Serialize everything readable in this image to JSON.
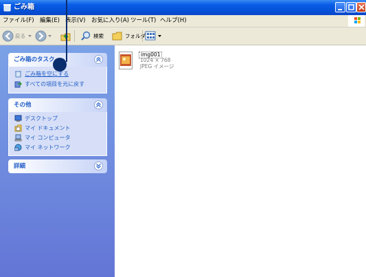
{
  "window": {
    "title": "ごみ箱"
  },
  "menu": [
    "ファイル(F)",
    "編集(E)",
    "表示(V)",
    "お気に入り(A)",
    "ツール(T)",
    "ヘルプ(H)"
  ],
  "toolbar": {
    "back_label": "戻る",
    "search_label": "検索",
    "folders_label": "フォルダ"
  },
  "tasks_panel": {
    "title": "ごみ箱のタスク",
    "items": [
      {
        "label": "ごみ箱を空にする",
        "icon": "empty-recycle-bin-icon"
      },
      {
        "label": "すべての項目を元に戻す",
        "icon": "restore-all-icon"
      }
    ]
  },
  "other_panel": {
    "title": "その他",
    "items": [
      {
        "label": "デスクトップ",
        "icon": "desktop-icon"
      },
      {
        "label": "マイ ドキュメント",
        "icon": "my-documents-icon"
      },
      {
        "label": "マイ コンピュータ",
        "icon": "my-computer-icon"
      },
      {
        "label": "マイ ネットワーク",
        "icon": "my-network-icon"
      }
    ]
  },
  "details_panel": {
    "title": "詳細"
  },
  "file": {
    "name": "img001",
    "dimensions": "1024 × 768",
    "type": "JPEG イメージ"
  },
  "colors": {
    "titlebar": "#0a5ee8",
    "taskpane": "#7ba2e7",
    "panel_title": "#215dc6",
    "callout": "#0a2d6e"
  }
}
